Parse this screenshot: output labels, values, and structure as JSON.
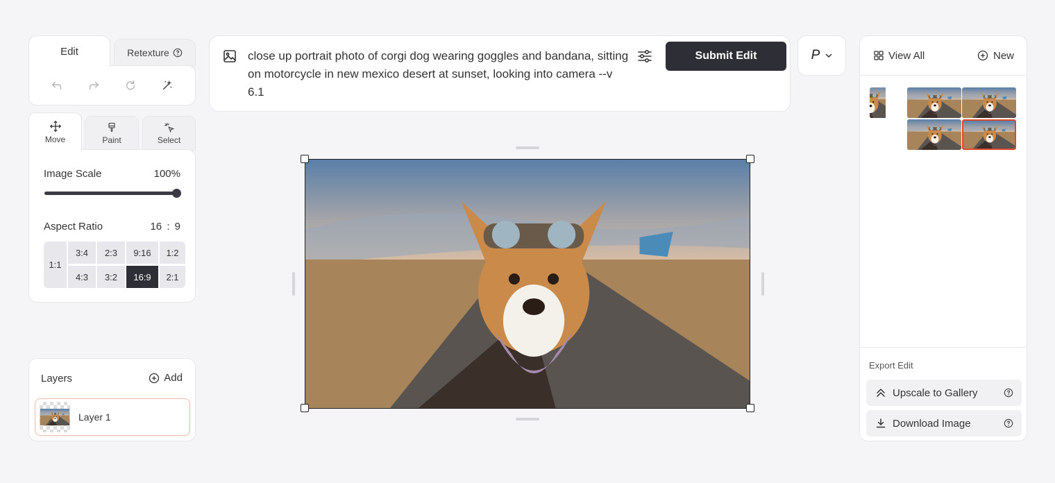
{
  "tabs": {
    "edit": "Edit",
    "retexture": "Retexture"
  },
  "tools": [
    "undo-icon",
    "redo-icon",
    "refresh-icon",
    "magic-icon"
  ],
  "modes": [
    {
      "label": "Move",
      "icon": "move-icon",
      "active": true
    },
    {
      "label": "Paint",
      "icon": "brush-icon",
      "active": false
    },
    {
      "label": "Select",
      "icon": "select-icon",
      "active": false
    }
  ],
  "settings": {
    "image_scale_label": "Image Scale",
    "image_scale_value": "100%",
    "image_scale_percent": 100,
    "aspect_ratio_label": "Aspect Ratio",
    "aspect_ratio_w": "16",
    "aspect_ratio_colon": ":",
    "aspect_ratio_h": "9",
    "ratios": {
      "r1_1": "1:1",
      "r3_4": "3:4",
      "r2_3": "2:3",
      "r9_16": "9:16",
      "r1_2": "1:2",
      "r4_3": "4:3",
      "r3_2": "3:2",
      "r16_9": "16:9",
      "r2_1": "2:1"
    },
    "selected_ratio": "16:9"
  },
  "layers": {
    "title": "Layers",
    "add_label": "Add",
    "items": [
      "Layer 1"
    ]
  },
  "prompt": {
    "text": "close up portrait photo of corgi dog wearing goggles and bandana, sitting on motorcycle in new mexico desert at sunset, looking into camera --v 6.1",
    "submit_label": "Submit Edit"
  },
  "personalize": {
    "label": "P"
  },
  "gallery": {
    "view_all_label": "View All",
    "new_label": "New"
  },
  "export": {
    "title": "Export Edit",
    "upscale_label": "Upscale to Gallery",
    "download_label": "Download Image"
  },
  "colors": {
    "accent_dark": "#2e2e36",
    "selection_red": "#e0452d",
    "layer_border": "#f2b9a6"
  }
}
